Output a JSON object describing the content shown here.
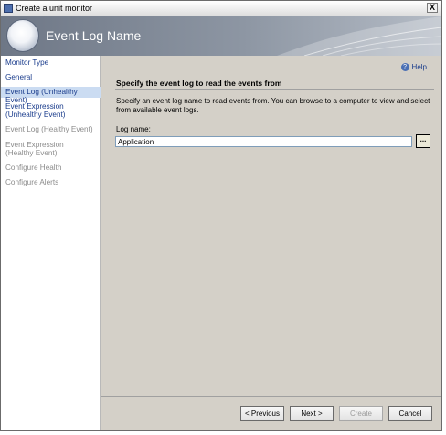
{
  "window": {
    "title": "Create a unit monitor",
    "close_glyph": "X"
  },
  "header": {
    "title": "Event Log Name"
  },
  "sidebar": {
    "items": [
      {
        "label": "Monitor Type",
        "state": "enabled"
      },
      {
        "label": "General",
        "state": "enabled"
      },
      {
        "label": "Event Log (Unhealthy Event)",
        "state": "selected"
      },
      {
        "label": "Event Expression (Unhealthy Event)",
        "state": "enabled"
      },
      {
        "label": "Event Log (Healthy Event)",
        "state": "disabled"
      },
      {
        "label": "Event Expression (Healthy Event)",
        "state": "disabled"
      },
      {
        "label": "Configure Health",
        "state": "disabled"
      },
      {
        "label": "Configure Alerts",
        "state": "disabled"
      }
    ]
  },
  "content": {
    "help": {
      "label": "Help",
      "icon": "help-icon"
    },
    "section_title": "Specify the event log to read the events from",
    "description": "Specify an event log name to read events from. You can browse to a computer to view and select from available event logs.",
    "log_name_label": "Log name:",
    "log_name_value": "Application",
    "browse_label": "..."
  },
  "footer": {
    "previous_label": "< Previous",
    "next_label": "Next >",
    "create_label": "Create",
    "cancel_label": "Cancel"
  },
  "colors": {
    "link": "#1a3c8c",
    "selected_bg": "#cbdcf2",
    "disabled": "#8c8c8c",
    "dialog_bg": "#d4d0c8"
  }
}
